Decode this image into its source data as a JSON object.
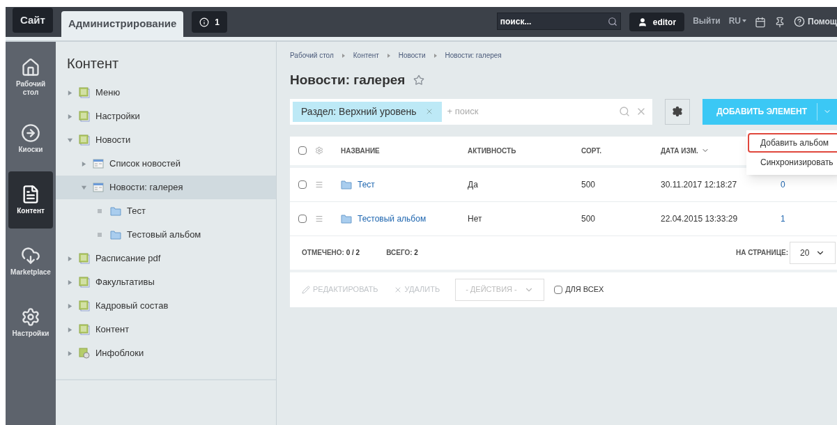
{
  "header": {
    "tabs": [
      {
        "label": "Сайт",
        "selected": false
      },
      {
        "label": "Администрирование",
        "selected": true
      }
    ],
    "notifications": "1",
    "search": {
      "placeholder": "поиск..."
    },
    "user": "editor",
    "logout": "Выйти",
    "language": "RU",
    "help": "Помощ"
  },
  "nav": [
    {
      "label": "Рабочий стол",
      "kind": "home",
      "selected": false
    },
    {
      "label": "Киоски",
      "kind": "arrow",
      "selected": false
    },
    {
      "label": "Контент",
      "kind": "document",
      "selected": true
    },
    {
      "label": "Marketplace",
      "kind": "cloud",
      "selected": false
    },
    {
      "label": "Настройки",
      "kind": "gear",
      "selected": false
    }
  ],
  "tree": {
    "title": "Контент",
    "items": [
      {
        "label": "Меню",
        "kind": "section",
        "expanded": false,
        "selected": false
      },
      {
        "label": "Настройки",
        "kind": "section",
        "expanded": false,
        "selected": false
      },
      {
        "label": "Новости",
        "kind": "section",
        "expanded": true,
        "selected": false,
        "children": [
          {
            "label": "Список новостей",
            "kind": "list",
            "expanded": false,
            "selected": false
          },
          {
            "label": "Новости: галерея",
            "kind": "list",
            "expanded": true,
            "selected": true,
            "children": [
              {
                "label": "Тест",
                "kind": "folder",
                "selected": false
              },
              {
                "label": "Тестовый альбом",
                "kind": "folder",
                "selected": false
              }
            ]
          }
        ]
      },
      {
        "label": "Расписание pdf",
        "kind": "section",
        "expanded": false,
        "selected": false
      },
      {
        "label": "Факультативы",
        "kind": "section",
        "expanded": false,
        "selected": false
      },
      {
        "label": "Кадровый состав",
        "kind": "section",
        "expanded": false,
        "selected": false
      },
      {
        "label": "Контент",
        "kind": "section",
        "expanded": false,
        "selected": false
      },
      {
        "label": "Инфоблоки",
        "kind": "infoblock",
        "expanded": false,
        "selected": false
      }
    ]
  },
  "breadcrumbs": [
    "Рабочий стол",
    "Контент",
    "Новости",
    "Новости: галерея"
  ],
  "page_title": "Новости: галерея",
  "filter": {
    "chip": "Раздел: Верхний уровень",
    "placeholder": "+ поиск"
  },
  "add_button": "ДОБАВИТЬ ЭЛЕМЕНТ",
  "add_menu": [
    {
      "label": "Добавить альбом",
      "selected": true
    },
    {
      "label": "Синхронизировать",
      "selected": false
    }
  ],
  "table": {
    "all_checked": false,
    "columns": [
      "НАЗВАНИЕ",
      "АКТИВНОСТЬ",
      "СОРТ.",
      "ДАТА ИЗМ."
    ],
    "rows": [
      {
        "checked": false,
        "name": "Тест",
        "active": "Да",
        "sort": "500",
        "date": "30.11.2017 12:18:27",
        "column_5": "0"
      },
      {
        "checked": false,
        "name": "Тестовый альбом",
        "active": "Нет",
        "sort": "500",
        "date": "22.04.2015 13:33:29",
        "column_5": "1"
      }
    ]
  },
  "footer": {
    "checked_label": "ОТМЕЧЕНО:",
    "checked_value": "0 / 2",
    "total_label": "ВСЕГО:",
    "total_value": "2",
    "per_page_label": "НА СТРАНИЦЕ:",
    "per_page": "20"
  },
  "actions": {
    "edit": {
      "label": "РЕДАКТИРОВАТЬ",
      "disabled": true
    },
    "delete": {
      "label": "УДАЛИТЬ",
      "disabled": true
    },
    "select": "- ДЕЙСТВИЯ -",
    "for_all": {
      "label": "ДЛЯ ВСЕХ",
      "checked": false
    }
  }
}
